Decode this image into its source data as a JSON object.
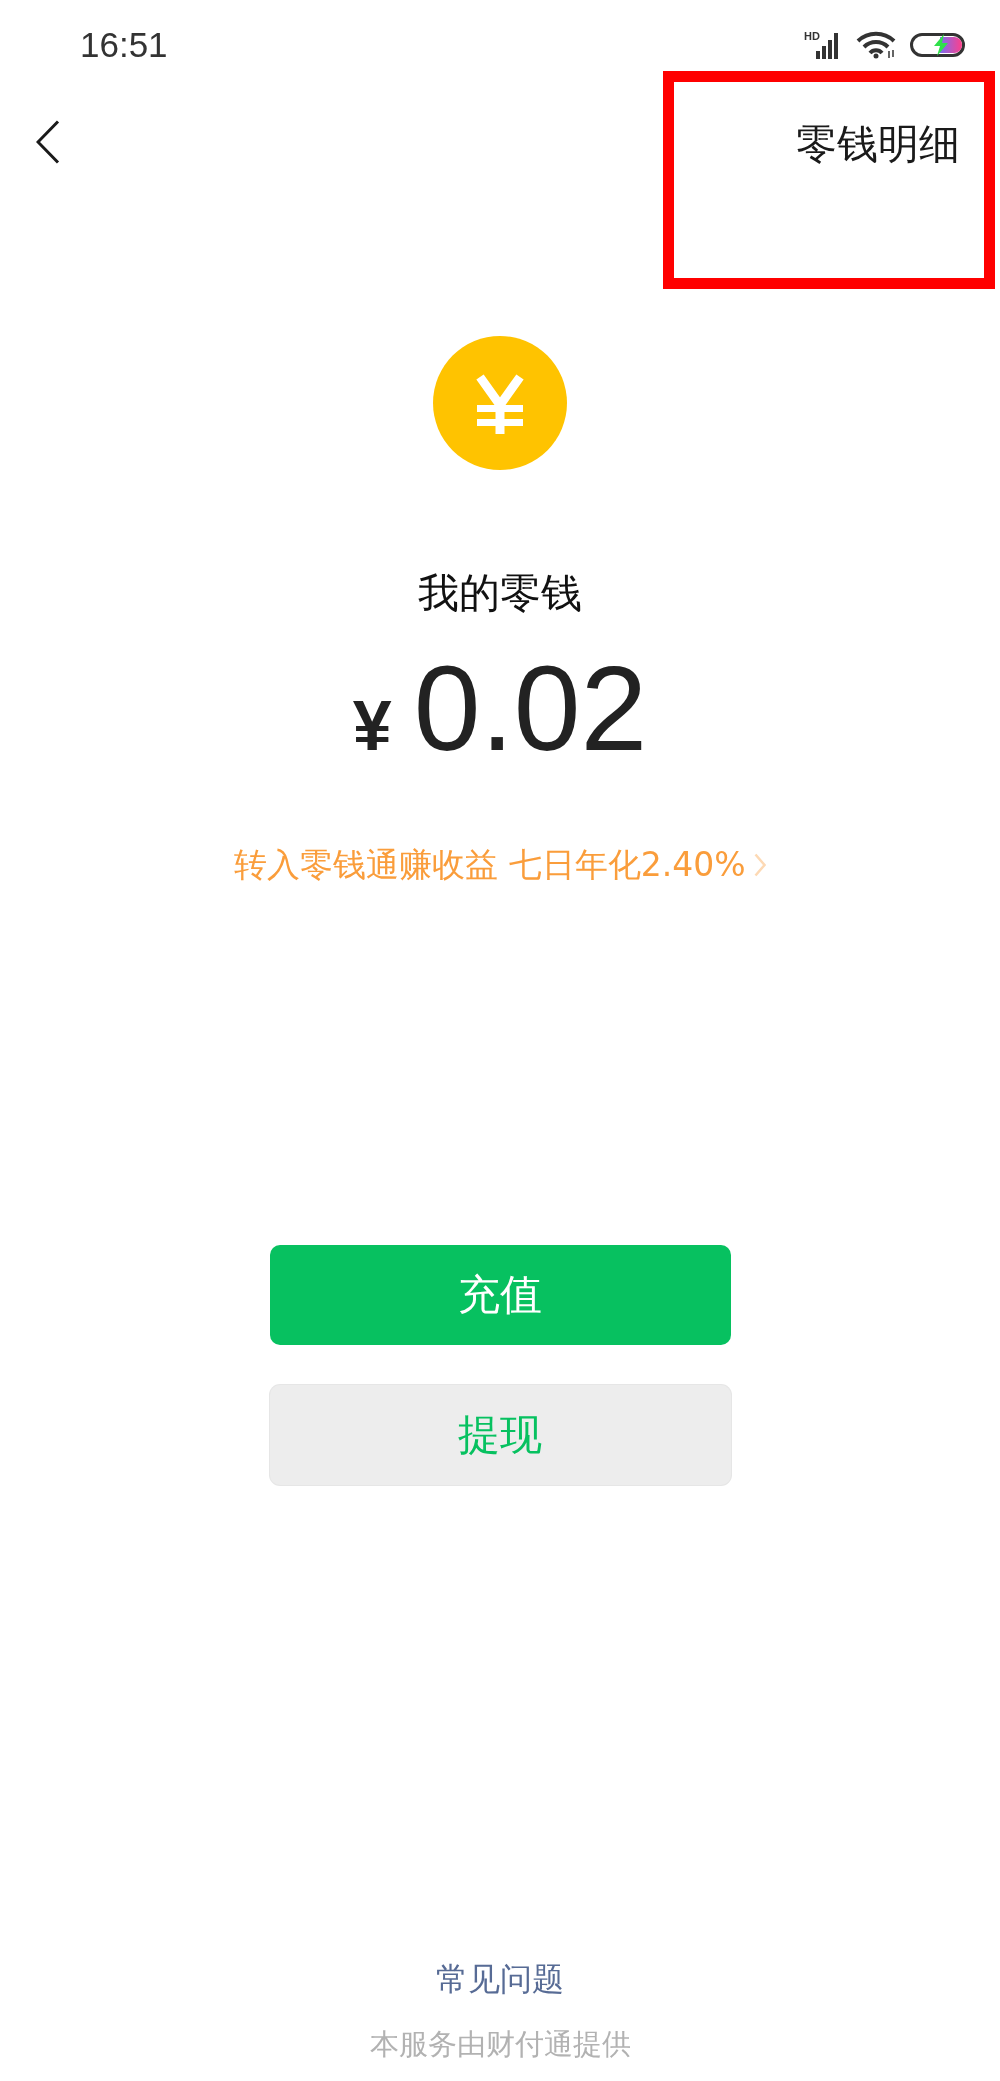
{
  "status_bar": {
    "time": "16:51",
    "network_label": "HD"
  },
  "header": {
    "action": {
      "label": "零钱明细",
      "highlighted": true
    }
  },
  "balance": {
    "title": "我的零钱",
    "currency": "¥",
    "amount": "0.02"
  },
  "promo": {
    "text": "转入零钱通赚收益 七日年化2.40%"
  },
  "buttons": [
    {
      "label": "充值",
      "kind": "primary"
    },
    {
      "label": "提现",
      "kind": "secondary"
    }
  ],
  "footer": {
    "link": "常见问题",
    "note": "本服务由财付通提供"
  }
}
